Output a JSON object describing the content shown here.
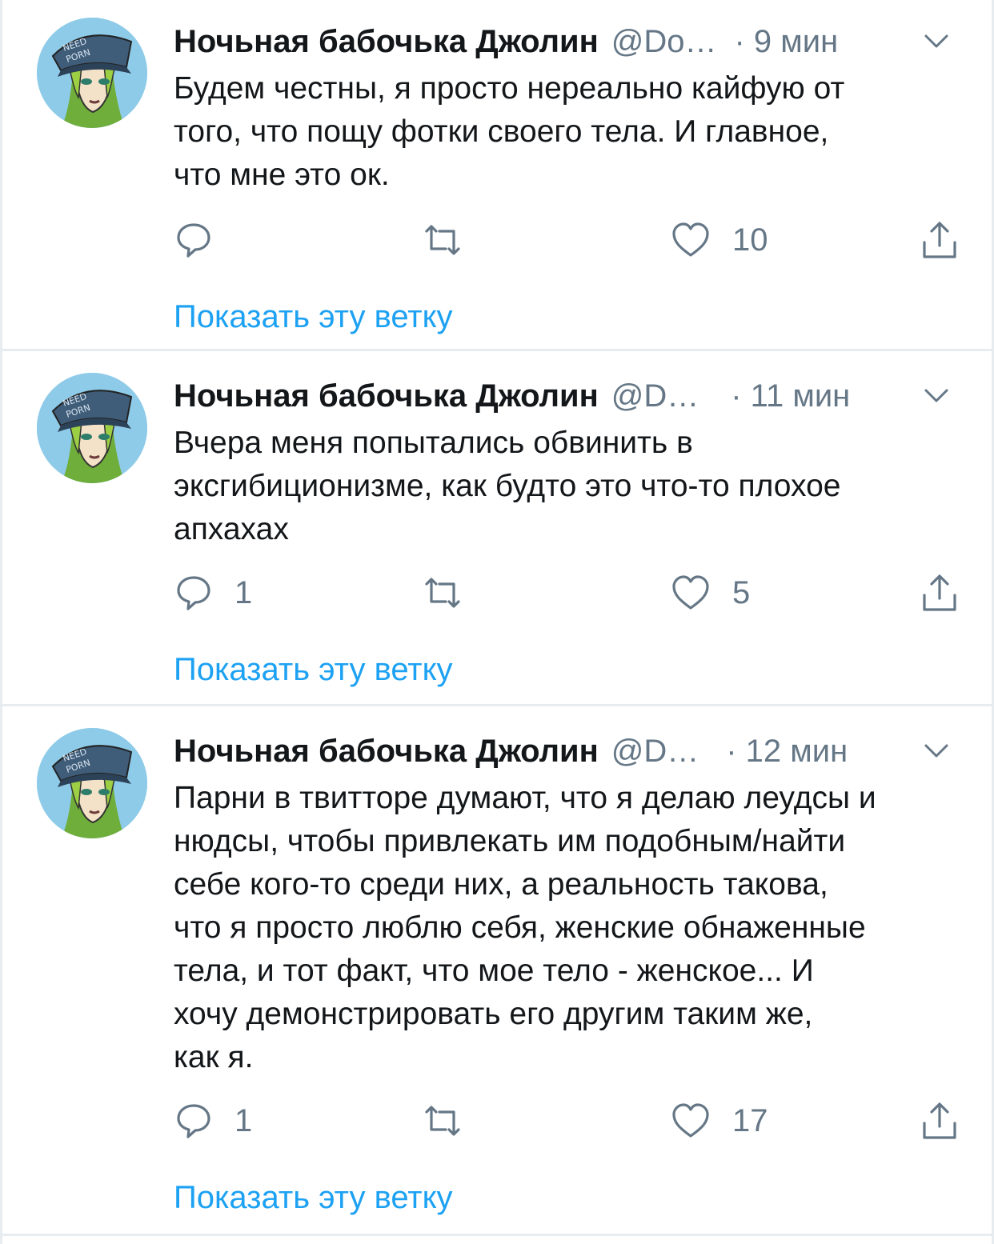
{
  "colors": {
    "link": "#1da1f2",
    "secondary_text": "#657786",
    "primary_text": "#14171a",
    "divider": "#e6ecf0"
  },
  "icons": {
    "reply": "speech-bubble-icon",
    "retweet": "retweet-arrows-icon",
    "like": "heart-outline-icon",
    "share": "share-upload-icon",
    "menu": "chevron-down-icon",
    "avatar_text": "NEED PORN"
  },
  "tweets": [
    {
      "name": "Ночьная бабочька Джолин",
      "handle": "@Do…",
      "time": "· 9 мин",
      "text": "Будем честны, я просто нереально кайфую от\nтого, что пощу фотки своего тела. И главное,\nчто мне это ок.",
      "replies": "",
      "retweets": "",
      "likes": "10",
      "show_thread": "Показать эту ветку"
    },
    {
      "name": "Ночьная бабочька Джолин",
      "handle": "@D…",
      "time": "· 11 мин",
      "text": "Вчера меня попытались обвинить в\nэксгибиционизме, как будто это что-то плохое\nапхахах",
      "replies": "1",
      "retweets": "",
      "likes": "5",
      "show_thread": "Показать эту ветку"
    },
    {
      "name": "Ночьная бабочька Джолин",
      "handle": "@D…",
      "time": "· 12 мин",
      "text": "Парни в твитторе думают, что я делаю леудсы и\nнюдсы, чтобы привлекать им подобным/найти\nсебе кого-то среди них, а реальность такова,\nчто я просто люблю себя, женские обнаженные\nтела, и тот факт, что мое тело - женское...  И\nхочу демонстрировать его другим таким же,\nкак я.",
      "replies": "1",
      "retweets": "",
      "likes": "17",
      "show_thread": "Показать эту ветку"
    }
  ]
}
